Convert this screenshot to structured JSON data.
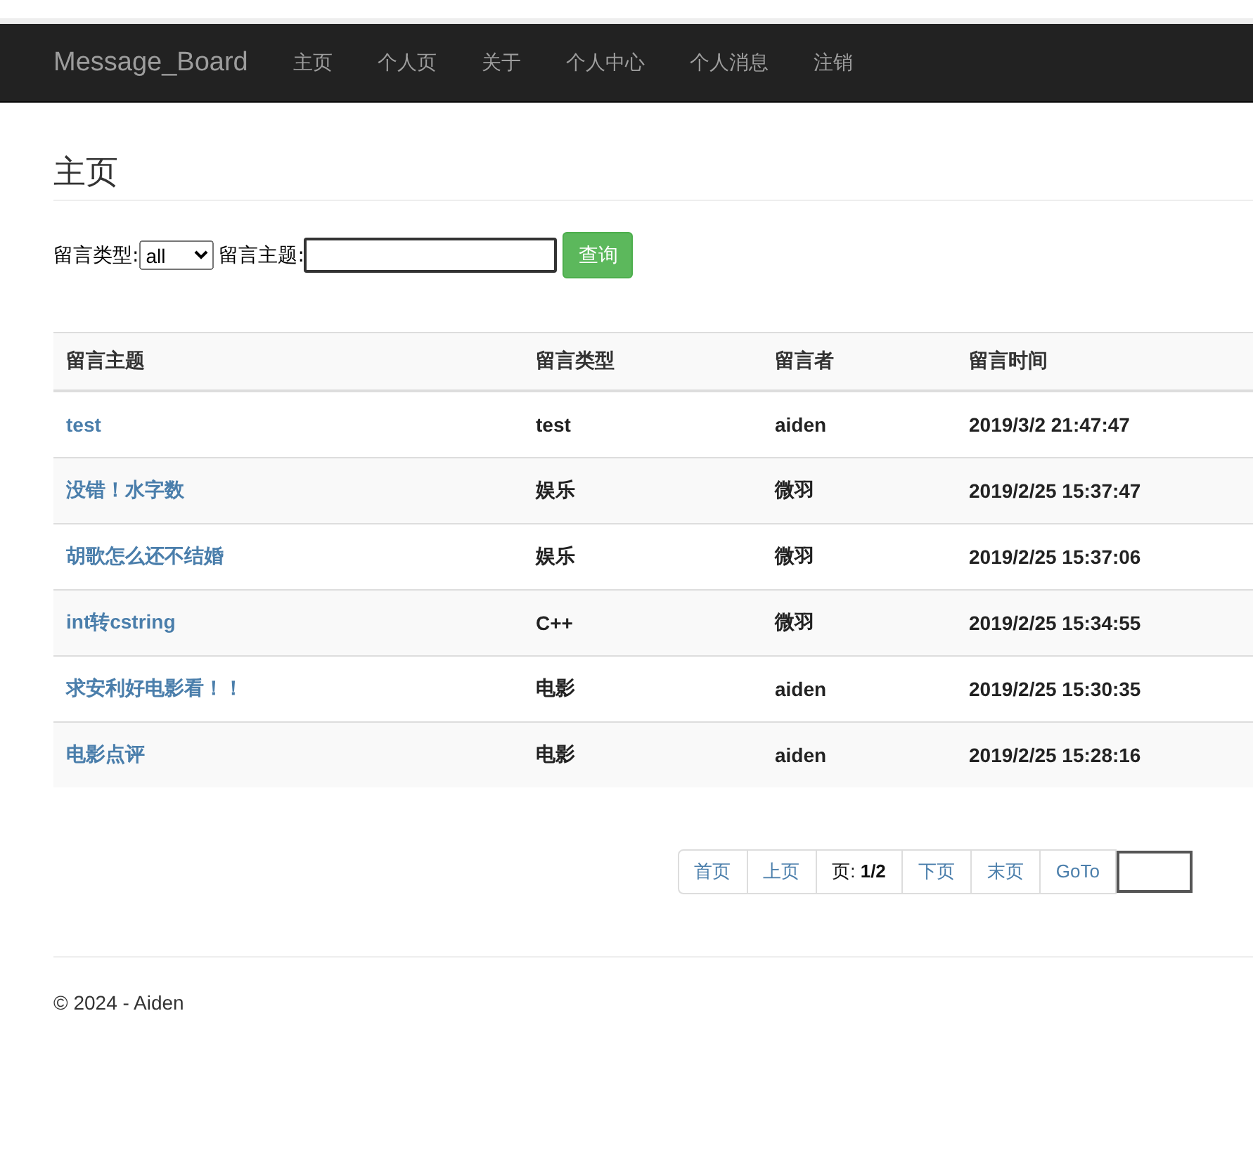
{
  "navbar": {
    "brand": "Message_Board",
    "items": [
      {
        "label": "主页"
      },
      {
        "label": "个人页"
      },
      {
        "label": "关于"
      },
      {
        "label": "个人中心"
      },
      {
        "label": "个人消息"
      },
      {
        "label": "注销"
      }
    ]
  },
  "page_title": "主页",
  "search": {
    "type_label": "留言类型:",
    "type_value": "all",
    "subject_label": "留言主题:",
    "button": "查询"
  },
  "table": {
    "columns": [
      "留言主题",
      "留言类型",
      "留言者",
      "留言时间"
    ],
    "rows": [
      {
        "subject": "test",
        "type": "test",
        "author": "aiden",
        "time": "2019/3/2 21:47:47"
      },
      {
        "subject": "没错！水字数",
        "type": "娱乐",
        "author": "微羽",
        "time": "2019/2/25 15:37:47"
      },
      {
        "subject": "胡歌怎么还不结婚",
        "type": "娱乐",
        "author": "微羽",
        "time": "2019/2/25 15:37:06"
      },
      {
        "subject": "int转cstring",
        "type": "C++",
        "author": "微羽",
        "time": "2019/2/25 15:34:55"
      },
      {
        "subject": "求安利好电影看！！",
        "type": "电影",
        "author": "aiden",
        "time": "2019/2/25 15:30:35"
      },
      {
        "subject": "电影点评",
        "type": "电影",
        "author": "aiden",
        "time": "2019/2/25 15:28:16"
      }
    ]
  },
  "pager": {
    "items": [
      {
        "kind": "link",
        "label": "首页"
      },
      {
        "kind": "link",
        "label": "上页"
      },
      {
        "kind": "info",
        "label": "页: **1/2**"
      },
      {
        "kind": "link",
        "label": "下页"
      },
      {
        "kind": "link",
        "label": "末页"
      },
      {
        "kind": "link",
        "label": "GoTo"
      },
      {
        "kind": "input"
      }
    ]
  },
  "footer": "© 2024 - Aiden"
}
